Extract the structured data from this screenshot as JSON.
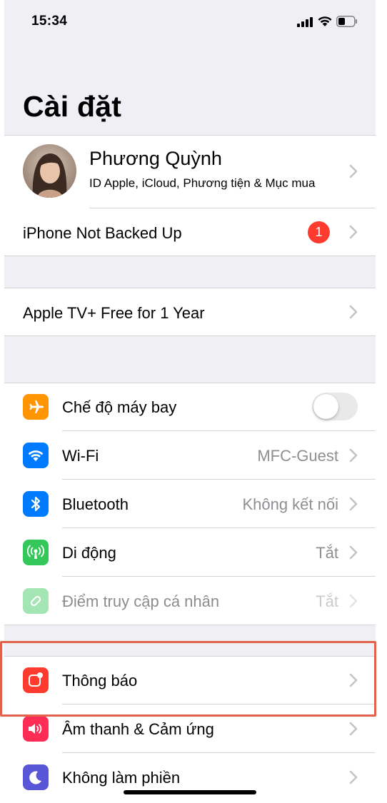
{
  "status_bar": {
    "time": "15:34",
    "icons": [
      "signal-icon",
      "wifi-icon",
      "battery-icon"
    ]
  },
  "page": {
    "title": "Cài đặt"
  },
  "profile": {
    "name": "Phương Quỳnh",
    "subtitle": "ID Apple, iCloud, Phương tiện & Mục mua"
  },
  "backup": {
    "label": "iPhone Not Backed Up",
    "badge": "1"
  },
  "promo": {
    "label": "Apple TV+ Free for 1 Year"
  },
  "connectivity": {
    "airplane": {
      "label": "Chế độ máy bay",
      "icon": "airplane-icon",
      "color": "#ff9500",
      "enabled": false
    },
    "wifi": {
      "label": "Wi-Fi",
      "value": "MFC-Guest",
      "icon": "wifi-icon",
      "color": "#007aff"
    },
    "bluetooth": {
      "label": "Bluetooth",
      "value": "Không kết nối",
      "icon": "bluetooth-icon",
      "color": "#007aff"
    },
    "cellular": {
      "label": "Di động",
      "value": "Tắt",
      "icon": "cellular-antenna-icon",
      "color": "#34c759"
    },
    "hotspot": {
      "label": "Điểm truy cập cá nhân",
      "value": "Tắt",
      "icon": "personal-hotspot-icon",
      "color": "#34c759"
    }
  },
  "notifications_group": {
    "notifications": {
      "label": "Thông báo",
      "icon": "notifications-icon",
      "color": "#ff3b30"
    },
    "sounds": {
      "label": "Âm thanh & Cảm ứng",
      "icon": "speaker-icon",
      "color": "#ff2d55"
    },
    "dnd": {
      "label": "Không làm phiền",
      "icon": "moon-icon",
      "color": "#5856d6"
    }
  },
  "highlight_color": "#e2634b"
}
